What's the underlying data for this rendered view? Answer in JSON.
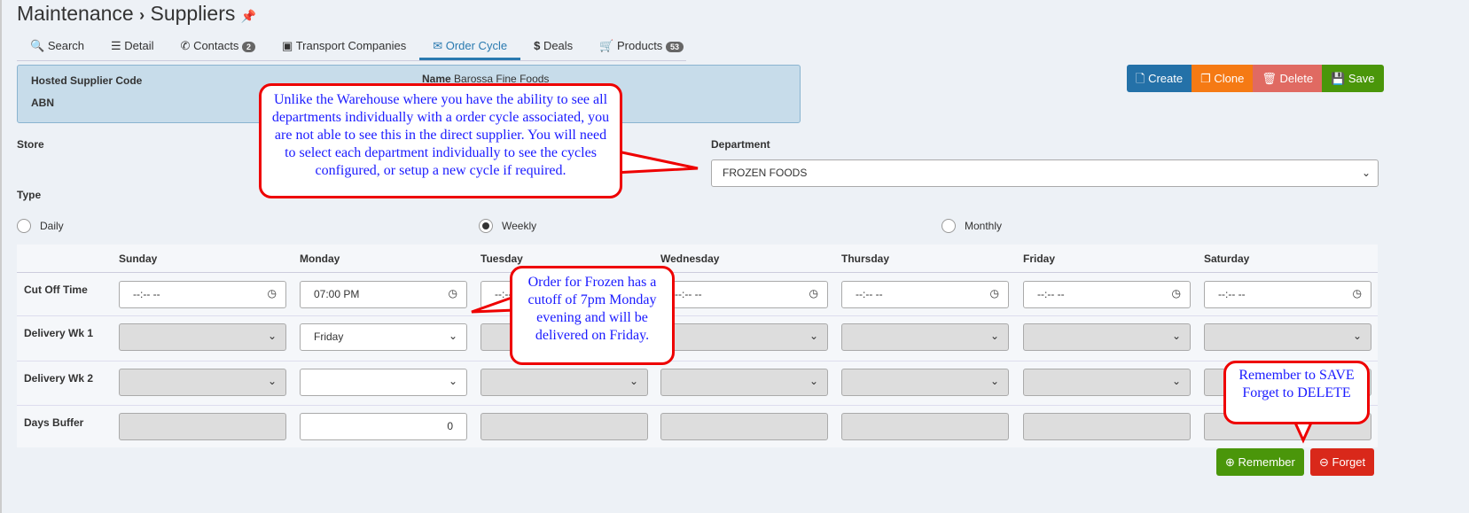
{
  "breadcrumb": {
    "parent": "Maintenance",
    "sep": "›",
    "current": "Suppliers",
    "pin_icon": "pin-icon"
  },
  "tabs": [
    {
      "label": "Search",
      "icon": "search-icon"
    },
    {
      "label": "Detail",
      "icon": "list-icon"
    },
    {
      "label": "Contacts",
      "icon": "phone-icon",
      "badge": "2"
    },
    {
      "label": "Transport Companies",
      "icon": "bus-icon"
    },
    {
      "label": "Order Cycle",
      "icon": "envelope-icon",
      "active": true
    },
    {
      "label": "Deals",
      "icon": "dollar-icon"
    },
    {
      "label": "Products",
      "icon": "cart-icon",
      "badge": "53"
    }
  ],
  "info": {
    "code_label": "Hosted Supplier Code",
    "abn_label": "ABN",
    "name_label": "Name",
    "name_value": "Barossa Fine Foods"
  },
  "actions": {
    "create": "Create",
    "clone": "Clone",
    "delete": "Delete",
    "save": "Save",
    "colors": {
      "create": "#2471a8",
      "clone": "#f57a14",
      "delete": "#e06a62",
      "save": "#4a960a"
    }
  },
  "form": {
    "store_label": "Store",
    "department_label": "Department",
    "department_value": "FROZEN FOODS",
    "type_label": "Type",
    "types": [
      {
        "label": "Daily",
        "checked": false
      },
      {
        "label": "Weekly",
        "checked": true
      },
      {
        "label": "Monthly",
        "checked": false
      }
    ]
  },
  "grid": {
    "days": [
      "Sunday",
      "Monday",
      "Tuesday",
      "Wednesday",
      "Thursday",
      "Friday",
      "Saturday"
    ],
    "rows": {
      "cutoff": "Cut Off Time",
      "wk1": "Delivery Wk 1",
      "wk2": "Delivery Wk 2",
      "buffer": "Days Buffer"
    },
    "empty_time": "--:-- --",
    "monday_cutoff": "07:00 PM",
    "monday_wk1": "Friday",
    "monday_buffer": "0"
  },
  "footer": {
    "remember": "Remember",
    "forget": "Forget"
  },
  "callouts": {
    "dept": "Unlike the Warehouse where you have the ability to see all departments individually with a order cycle associated, you are not able to see this in the direct supplier.  You will need to select each department individually to see the cycles configured, or setup a new cycle if required.",
    "cutoff": "Order for Frozen has a cutoff of 7pm Monday evening and will be delivered on Friday.",
    "save": "Remember to SAVE Forget to DELETE"
  }
}
